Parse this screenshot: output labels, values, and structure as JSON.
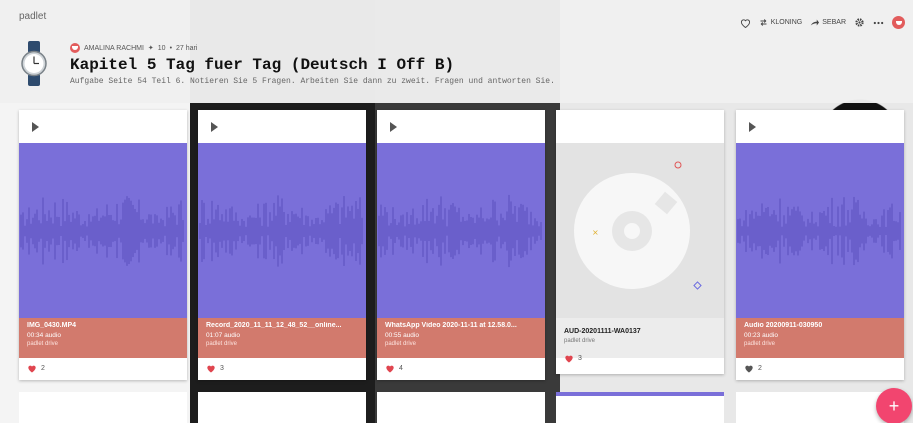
{
  "brand": "padlet",
  "toolbar": {
    "like_label": "",
    "clone_label": "KLONING",
    "share_label": "SEBAR"
  },
  "header": {
    "author": "AMALINA RACHMI",
    "score": "10",
    "time": "27 hari",
    "title": "Kapitel 5 Tag fuer Tag (Deutsch I Off B)",
    "subtitle": "Aufgabe Seite 54 Teil 6. Notieren Sie 5 Fragen. Arbeiten Sie dann zu zweit. Fragen und antworten Sie."
  },
  "posts": [
    {
      "filename": "IMG_0430.MP4",
      "duration": "00:34 audio",
      "source": "padlet drive",
      "likes": "2",
      "style": "audio"
    },
    {
      "filename": "Record_2020_11_11_12_48_52__online...",
      "duration": "01:07 audio",
      "source": "padlet drive",
      "likes": "3",
      "style": "audio"
    },
    {
      "filename": "WhatsApp Video 2020-11-11 at 12.58.0...",
      "duration": "00:55 audio",
      "source": "padlet drive",
      "likes": "4",
      "style": "audio"
    },
    {
      "filename": "AUD-20201111-WA0137",
      "duration": "",
      "source": "padlet drive",
      "likes": "3",
      "style": "disc"
    },
    {
      "filename": "Audio 20200911-030950",
      "duration": "00:23 audio",
      "source": "padlet drive",
      "likes": "2",
      "style": "audio"
    }
  ],
  "fab": "+",
  "colors": {
    "audio_bg": "#7a6fd9",
    "info_bg": "#d27a6d",
    "fab": "#f2456f",
    "heart_red": "#e0454f",
    "heart_gray": "#555555"
  }
}
